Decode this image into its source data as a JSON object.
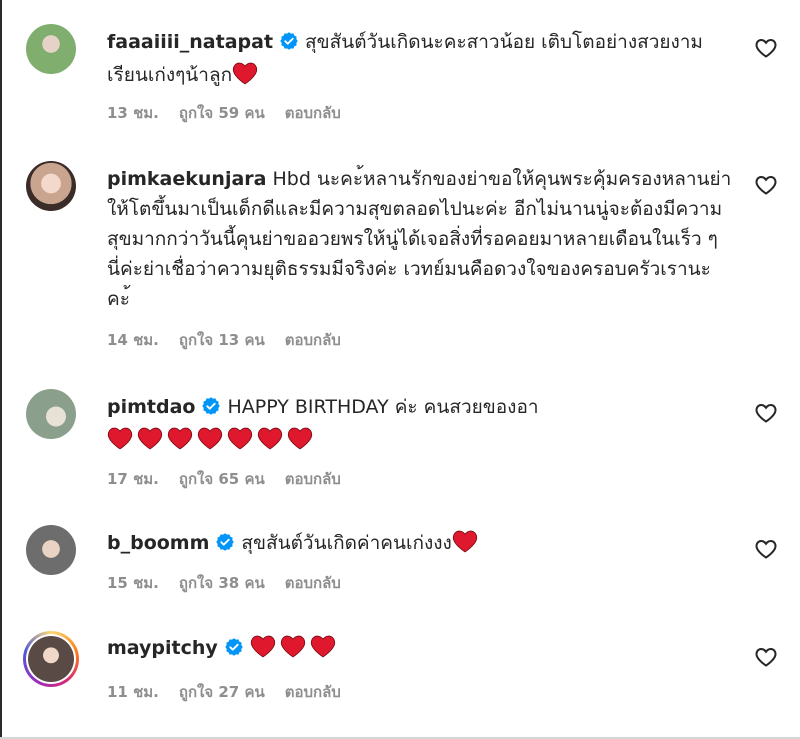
{
  "comments": [
    {
      "username": "faaaiiii_natapat",
      "verified": true,
      "text": "สุขสันต์วันเกิดนะคะสาวน้อย เติบโตอย่างสวยงามเรียนเก่งๆน้าลูก",
      "heart_emojis": 1,
      "time": "13 ชม.",
      "likes": "ถูกใจ 59 คน",
      "reply": "ตอบกลับ",
      "avatar_color": "#7fae6e"
    },
    {
      "username": "pimkaekunjara",
      "verified": false,
      "text": "Hbd นะคะ้หลานรักของย่าขอให้คุนพระคุ้มครองหลานย่าให้โตขึ้นมาเป็นเด็กดีและมีความสุขตลอดไปนะค่ะ อีกไม่นานนู่จะต้องมีความสุขมากกว่าวันนี้คุนย่าขออวยพรให้นู่ได้เจอสิ่งที่รอคอยมาหลายเดือนในเร็ว ๆ นี่ค่ะย่าเชื่อว่าความยุติธรรมมีจริงค่ะ เวทย์มนคือดวงใจของครอบครัวเรานะคะ้",
      "heart_emojis": 0,
      "time": "14 ชม.",
      "likes": "ถูกใจ 13 คน",
      "reply": "ตอบกลับ",
      "avatar_color": "#c9a48e"
    },
    {
      "username": "pimtdao",
      "verified": true,
      "text": "HAPPY BIRTHDAY ค่ะ คนสวยของอา",
      "heart_emojis": 7,
      "time": "17 ชม.",
      "likes": "ถูกใจ 65 คน",
      "reply": "ตอบกลับ",
      "avatar_color": "#8aa08c"
    },
    {
      "username": "b_boomm",
      "verified": true,
      "text": "สุขสันต์วันเกิดค่าคนเก่งงง",
      "heart_emojis": 1,
      "time": "15 ชม.",
      "likes": "ถูกใจ 38 คน",
      "reply": "ตอบกลับ",
      "avatar_color": "#6d6d6d"
    },
    {
      "username": "maypitchy",
      "verified": true,
      "text": "",
      "heart_emojis": 3,
      "time": "11 ชม.",
      "likes": "ถูกใจ 27 คน",
      "reply": "ตอบกลับ",
      "avatar_color": "#5a4a46",
      "has_story_ring": true
    }
  ],
  "colors": {
    "verified": "#0095f6",
    "heart_emoji": "#e0182d",
    "meta_text": "#8e8e8e",
    "text": "#262626"
  },
  "icons": {
    "verified": "verified-badge-icon",
    "like": "heart-outline-icon",
    "emoji": "red-heart-emoji"
  }
}
